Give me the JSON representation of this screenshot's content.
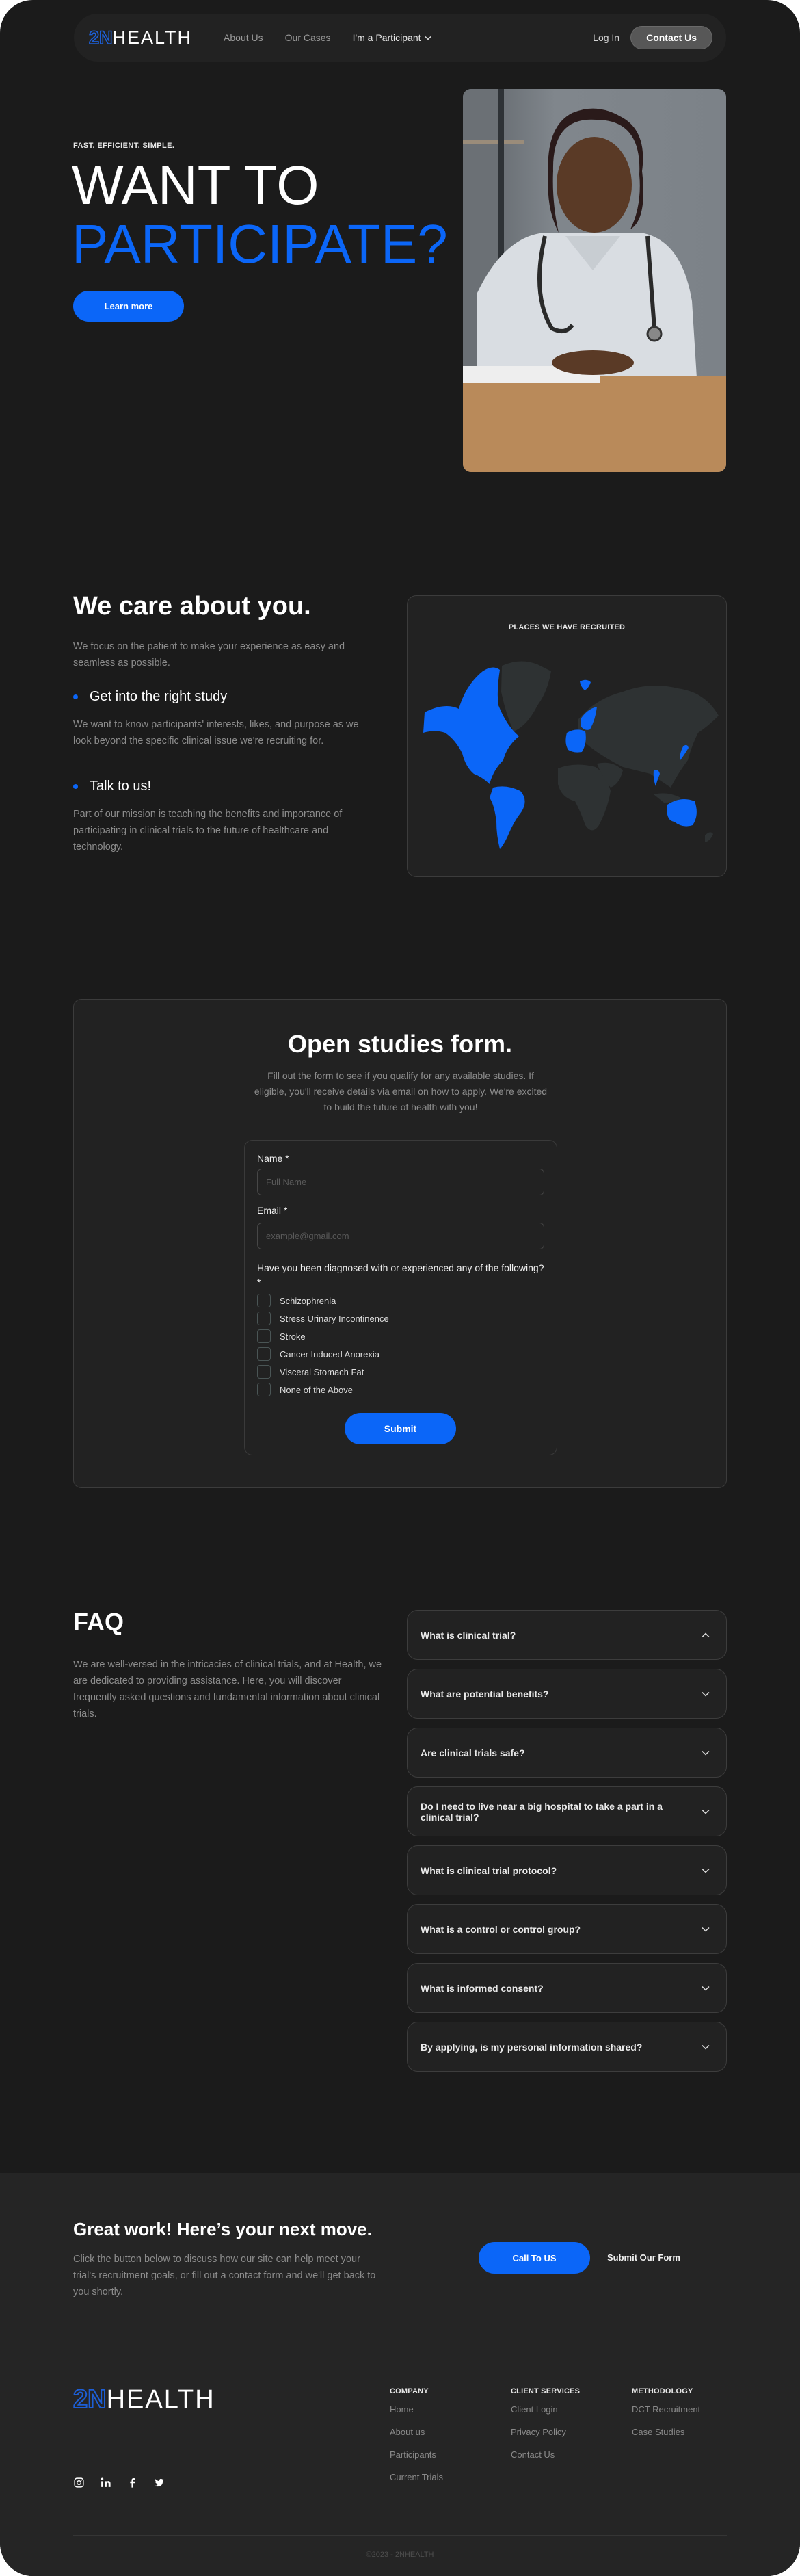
{
  "brand": {
    "logo_outline": "2N",
    "logo_solid": "HEALTH",
    "accent_color": "#0b66f8"
  },
  "nav": {
    "links": [
      "About Us",
      "Our Cases",
      "I'm a Participant"
    ],
    "login": "Log In",
    "contact": "Contact Us"
  },
  "hero": {
    "eyebrow": "FAST. EFFICIENT. SIMPLE.",
    "title_line1": "WANT TO",
    "title_line2": "PARTICIPATE?",
    "button": "Learn more",
    "image_alt": "Smiling doctor in white coat with stethoscope writing at desk"
  },
  "care": {
    "title": "We care about you.",
    "intro": "We focus on the patient to make your experience as easy and seamless as possible.",
    "points": [
      {
        "title": "Get into the right study",
        "text": "We want to know participants' interests, likes, and purpose as we look beyond the specific clinical issue we're recruiting for."
      },
      {
        "title": "Talk to us!",
        "text": "Part of our mission is teaching the benefits and importance of participating in clinical trials to the future of healthcare and technology."
      }
    ],
    "map_title": "PLACES WE HAVE RECRUITED",
    "recruited_regions": [
      "North America",
      "South America",
      "Western Europe",
      "Scandinavia",
      "Svalbard",
      "Japan",
      "Thailand",
      "Australia"
    ]
  },
  "form": {
    "title": "Open studies form.",
    "subtitle": "Fill out the form to see if you qualify for any available studies. If eligible, you'll receive details via email on how to apply. We're excited to build the future of health with you!",
    "name_label": "Name *",
    "name_placeholder": "Full Name",
    "email_label": "Email *",
    "email_placeholder": "example@gmail.com",
    "question": "Have you been diagnosed with or experienced any of the following? *",
    "options": [
      "Schizophrenia",
      "Stress Urinary Incontinence",
      "Stroke",
      "Cancer Induced Anorexia",
      "Visceral Stomach Fat",
      "None of the Above"
    ],
    "submit": "Submit"
  },
  "faq": {
    "title": "FAQ",
    "intro": "We are well-versed in the intricacies of clinical trials, and at Health, we are dedicated to providing assistance. Here, you will discover frequently asked questions and fundamental information about clinical trials.",
    "items": [
      {
        "q": "What is clinical trial?",
        "expanded": true
      },
      {
        "q": "What are potential benefits?",
        "expanded": false
      },
      {
        "q": "Are clinical trials safe?",
        "expanded": false
      },
      {
        "q": " Do I need to live near a big hospital to take a part in a clinical trial?",
        "expanded": false
      },
      {
        "q": "What is clinical trial protocol?",
        "expanded": false
      },
      {
        "q": "What is a control or control group?",
        "expanded": false
      },
      {
        "q": "What is informed consent?",
        "expanded": false
      },
      {
        "q": "By applying, is my personal information shared?",
        "expanded": false
      }
    ]
  },
  "cta": {
    "title": "Great work! Here’s your next move.",
    "text": "Click the button below to discuss how our site can help meet your trial's recruitment goals, or fill out a contact form and we'll get back to you shortly.",
    "call_button": "Call To US",
    "form_link": "Submit Our Form"
  },
  "footer": {
    "columns": [
      {
        "heading": "COMPANY",
        "links": [
          "Home",
          "About us",
          "Participants",
          "Current Trials"
        ]
      },
      {
        "heading": "CLIENT SERVICES",
        "links": [
          "Client Login",
          "Privacy Policy",
          "Contact Us"
        ]
      },
      {
        "heading": "METHODOLOGY",
        "links": [
          "DCT Recruitment",
          "Case Studies"
        ]
      }
    ],
    "socials": [
      "instagram-icon",
      "linkedin-icon",
      "facebook-icon",
      "twitter-icon"
    ],
    "copyright": "©2023 - 2NHEALTH"
  }
}
